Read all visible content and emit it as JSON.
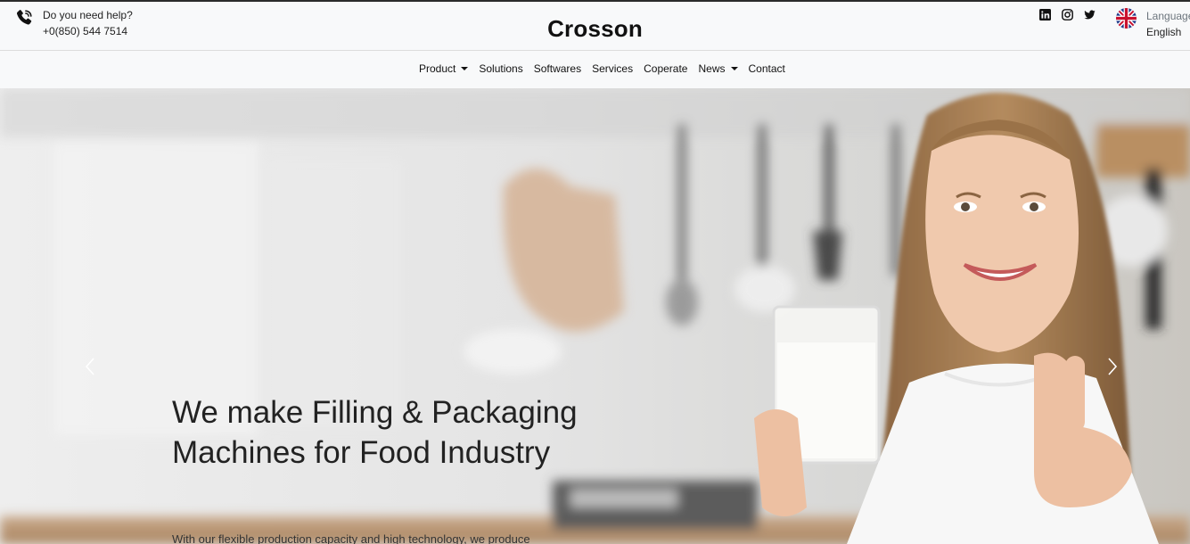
{
  "topbar": {
    "help_label": "Do you need help?",
    "phone": "+0(850) 544 7514",
    "brand": "Crosson",
    "language_label": "Language",
    "language_value": "English",
    "socials": [
      "linkedin-icon",
      "instagram-icon",
      "twitter-icon"
    ]
  },
  "nav": {
    "items": [
      {
        "label": "Product",
        "dropdown": true
      },
      {
        "label": "Solutions",
        "dropdown": false
      },
      {
        "label": "Softwares",
        "dropdown": false
      },
      {
        "label": "Services",
        "dropdown": false
      },
      {
        "label": "Coperate",
        "dropdown": false
      },
      {
        "label": "News",
        "dropdown": true
      },
      {
        "label": "Contact",
        "dropdown": false
      }
    ]
  },
  "hero": {
    "headline": "We make Filling & Packaging Machines for Food Industry",
    "lead": "With our flexible production capacity and high technology, we produce"
  },
  "colors": {
    "topline": "#2b2b2b",
    "navbar_bg": "#f8f9fa",
    "text": "#212529"
  }
}
